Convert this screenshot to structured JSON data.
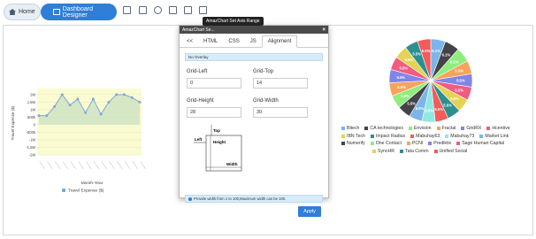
{
  "breadcrumb": {
    "home": "Home",
    "dashboard": "Dashboard Designer"
  },
  "toolbar": {
    "tooltip": "AmazChart Set Axis Range",
    "icons": [
      "save-icon",
      "image-icon",
      "refresh-icon",
      "layout-icon",
      "grid-icon",
      "window-icon"
    ]
  },
  "dialog": {
    "title": "AmazChart Se...",
    "close": "×",
    "tabs": [
      "<<",
      "HTML",
      "CSS",
      "JS",
      "Alignment"
    ],
    "active_tab": "Alignment",
    "info": "No Overlay",
    "grid_left_label": "Grid-Left",
    "grid_left_value": "0",
    "grid_top_label": "Grid-Top",
    "grid_top_value": "14",
    "grid_height_label": "Grid-Height",
    "grid_height_value": "28",
    "grid_width_label": "Grid-Width",
    "grid_width_value": "30",
    "diagram": {
      "top": "Top",
      "left": "Left",
      "height": "Height",
      "width": "Width"
    },
    "bottom_info": "Provide width from 1 to 100,Maximum width can be 100.",
    "apply": "Apply"
  },
  "chart_data": [
    {
      "type": "area",
      "ylabel": "Travel Expense ($)",
      "xlabel": "Month-Year",
      "y_ticks": [
        "2M",
        "1.5M",
        "1M",
        "500k",
        "0",
        "-500k",
        "-1M",
        "-1.5M",
        "-2M"
      ],
      "ylim": [
        -2,
        2.4
      ],
      "series": [
        {
          "name": "Travel Expense ($)",
          "values": [
            0.6,
            0.6,
            1.2,
            2.0,
            1.3,
            1.7,
            0.8,
            1.7,
            0.7,
            1.5,
            2.0,
            2.0,
            1.8,
            1.5
          ]
        }
      ],
      "colors": {
        "fill": "#f5f5a8",
        "line": "#7fa8d8"
      }
    },
    {
      "type": "pie",
      "slices": [
        {
          "label": "Bitech",
          "value": 6.1,
          "color": "#7cb5ec"
        },
        {
          "label": "CA technologies",
          "value": 6.1,
          "color": "#434348"
        },
        {
          "label": "Envision",
          "value": 6.1,
          "color": "#90ed7d"
        },
        {
          "label": "Fractal",
          "value": 5.5,
          "color": "#f7a35c"
        },
        {
          "label": "GridRX",
          "value": 5.5,
          "color": "#8085e9"
        },
        {
          "label": "Hcentive",
          "value": 5.5,
          "color": "#f15c80"
        },
        {
          "label": "IBN Tech",
          "value": 5.5,
          "color": "#e4d354"
        },
        {
          "label": "Impact Radius",
          "value": 5.5,
          "color": "#2b908f"
        },
        {
          "label": "Mabuhay63",
          "value": 5.5,
          "color": "#f45b5b"
        },
        {
          "label": "Mabuhay73",
          "value": 5.5,
          "color": "#91e8e1"
        },
        {
          "label": "Market Link",
          "value": 5.5,
          "color": "#7cb5ec"
        },
        {
          "label": "Numerify",
          "value": 5.5,
          "color": "#434348"
        },
        {
          "label": "One Contact",
          "value": 5.5,
          "color": "#90ed7d"
        },
        {
          "label": "PCNI",
          "value": 5.5,
          "color": "#f7a35c"
        },
        {
          "label": "Prediktiv",
          "value": 5.5,
          "color": "#8085e9"
        },
        {
          "label": "Sage Human Capital",
          "value": 5.5,
          "color": "#f15c80"
        },
        {
          "label": "SyncHR",
          "value": 5.5,
          "color": "#e4d354"
        },
        {
          "label": "Tata Comm",
          "value": 5.5,
          "color": "#2b908f"
        },
        {
          "label": "Unified Social",
          "value": 5.5,
          "color": "#f45b5b"
        }
      ],
      "legend_order": [
        "Bitech",
        "CA technologies",
        "Envision",
        "Fractal",
        "GridRX",
        "Hcentive",
        "IBN Tech",
        "Impact Radius",
        "Mabuhay63",
        "Mabuhay73",
        "Market Link",
        "Numerify",
        "One Contact",
        "PCNI",
        "Prediktiv",
        "Sage Human Capital",
        "SyncHR",
        "Tata Comm",
        "Unified Social"
      ]
    }
  ]
}
